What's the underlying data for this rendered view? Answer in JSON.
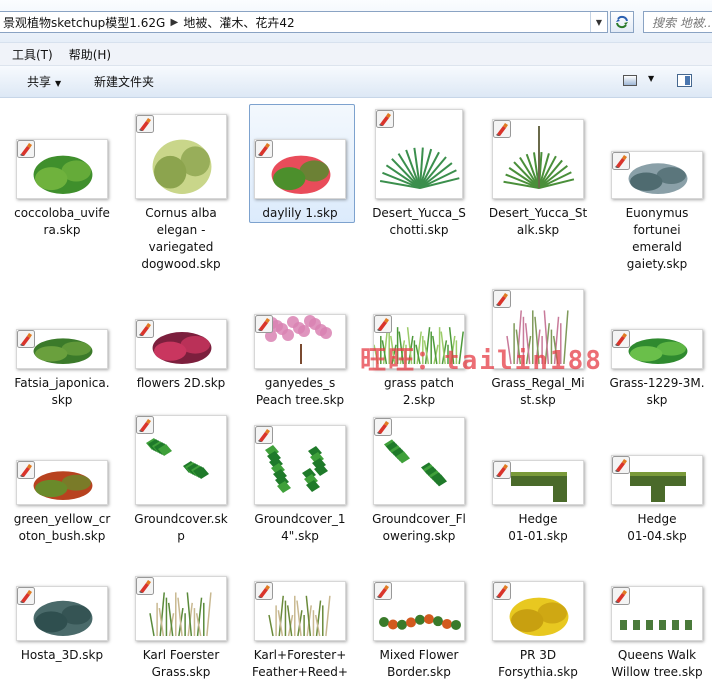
{
  "address": {
    "segments": [
      "景观植物sketchup模型1.62G",
      "地被、灌木、花卉42"
    ],
    "search_placeholder": "搜索 地被..."
  },
  "menu": [
    "工具(T)",
    "帮助(H)"
  ],
  "toolbar": {
    "share_label": "共享",
    "new_folder_label": "新建文件夹"
  },
  "watermark": "旺旺：tailin188",
  "files": [
    {
      "name": "coccoloba_uvifera.skp",
      "lines": [
        "coccoloba_uvife",
        "ra.skp"
      ]
    },
    {
      "name": "Cornus alba elegan - variegated dogwood.skp",
      "lines": [
        "Cornus alba",
        "elegan -",
        "variegated",
        "dogwood.skp"
      ]
    },
    {
      "name": "daylily 1.skp",
      "lines": [
        "daylily 1.skp"
      ]
    },
    {
      "name": "Desert_Yucca_Schotti.skp",
      "lines": [
        "Desert_Yucca_S",
        "chotti.skp"
      ]
    },
    {
      "name": "Desert_Yucca_Stalk.skp",
      "lines": [
        "Desert_Yucca_St",
        "alk.skp"
      ]
    },
    {
      "name": "Euonymus fortunei emerald gaiety.skp",
      "lines": [
        "Euonymus",
        "fortunei",
        "emerald",
        "gaiety.skp"
      ]
    },
    {
      "name": "Fatsia_japonica.skp",
      "lines": [
        "Fatsia_japonica.",
        "skp"
      ]
    },
    {
      "name": "flowers 2D.skp",
      "lines": [
        "flowers 2D.skp"
      ]
    },
    {
      "name": "ganyedes_s Peach tree.skp",
      "lines": [
        "ganyedes_s",
        "Peach tree.skp"
      ]
    },
    {
      "name": "grass patch 2.skp",
      "lines": [
        "grass patch",
        "2.skp"
      ]
    },
    {
      "name": "Grass_Regal_Mist.skp",
      "lines": [
        "Grass_Regal_Mi",
        "st.skp"
      ]
    },
    {
      "name": "Grass-1229-3M.skp",
      "lines": [
        "Grass-1229-3M.",
        "skp"
      ]
    },
    {
      "name": "green_yellow_croton_bush.skp",
      "lines": [
        "green_yellow_cr",
        "oton_bush.skp"
      ]
    },
    {
      "name": "Groundcover.skp",
      "lines": [
        "Groundcover.sk",
        "p"
      ]
    },
    {
      "name": "Groundcover_14\".skp",
      "lines": [
        "Groundcover_1",
        "4\".skp"
      ]
    },
    {
      "name": "Groundcover_Flowering.skp",
      "lines": [
        "Groundcover_Fl",
        "owering.skp"
      ]
    },
    {
      "name": "Hedge 01-01.skp",
      "lines": [
        "Hedge",
        "01-01.skp"
      ]
    },
    {
      "name": "Hedge 01-04.skp",
      "lines": [
        "Hedge",
        "01-04.skp"
      ]
    },
    {
      "name": "Hosta_3D.skp",
      "lines": [
        "Hosta_3D.skp"
      ]
    },
    {
      "name": "Karl Foerster Grass.skp",
      "lines": [
        "Karl Foerster",
        "Grass.skp"
      ]
    },
    {
      "name": "Karl+Forester+Feather+Reed+",
      "lines": [
        "Karl+Forester+",
        "Feather+Reed+"
      ]
    },
    {
      "name": "Mixed Flower Border.skp",
      "lines": [
        "Mixed Flower",
        "Border.skp"
      ]
    },
    {
      "name": "PR 3D Forsythia.skp",
      "lines": [
        "PR 3D",
        "Forsythia.skp"
      ]
    },
    {
      "name": "Queens Walk Willow tree.skp",
      "lines": [
        "Queens Walk",
        "Willow tree.skp"
      ]
    }
  ]
}
